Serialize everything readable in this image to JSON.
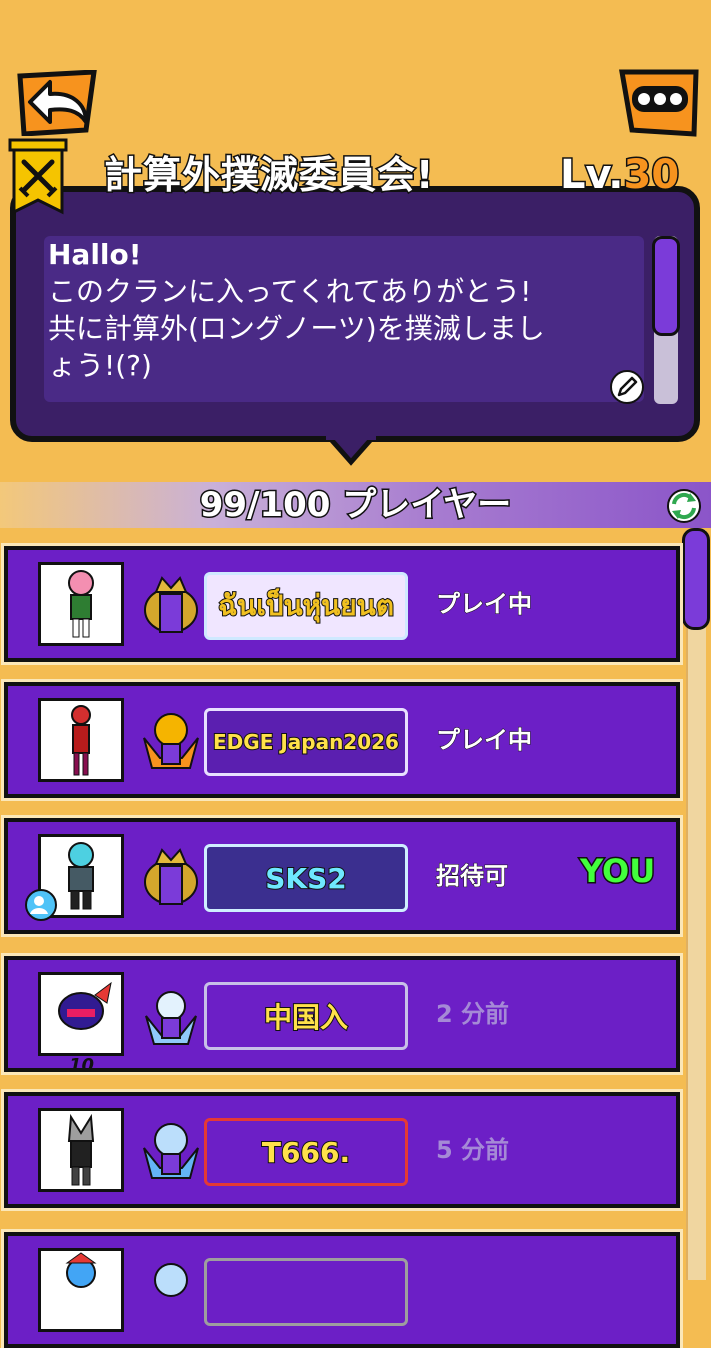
{
  "header": {
    "clan_name": "計算外撲滅委員会!",
    "level_prefix": "Lv.",
    "level_value": "30",
    "back_icon": "back-arrow-icon",
    "menu_icon": "more-dots-icon"
  },
  "description": {
    "line1": "Hallo!",
    "line2": "このクランに入ってくれてありがとう!",
    "line3": "共に計算外(ロングノーツ)を撲滅しまし",
    "line4": "ょう!(?)",
    "edit_icon": "pencil-icon"
  },
  "players": {
    "count_label": "99/100 プレイヤー",
    "refresh_icon": "refresh-icon"
  },
  "members": [
    {
      "name": "ฉันเป็นหุ่นยนต",
      "status": "プレイ中",
      "plate_color": "#f0e6ff"
    },
    {
      "name": "EDGE Japan2026",
      "status": "プレイ中",
      "plate_color": "#5b1fb0"
    },
    {
      "name": "SKS2",
      "status": "招待可",
      "you": "YOU",
      "plate_color": "#3b2f8f"
    },
    {
      "name": "中国入",
      "status": "2 分前",
      "level_badge": "10",
      "plate_color": "#6c1fc6"
    },
    {
      "name": "T666.",
      "status": "5 分前",
      "plate_color": "#6c1fc6"
    },
    {
      "name": "",
      "status": "",
      "plate_color": "#6c1fc6"
    }
  ],
  "colors": {
    "background": "#f4bc52",
    "row": "#6c1fc6",
    "accent_orange": "#f7931e",
    "you_green": "#42ff3c"
  }
}
